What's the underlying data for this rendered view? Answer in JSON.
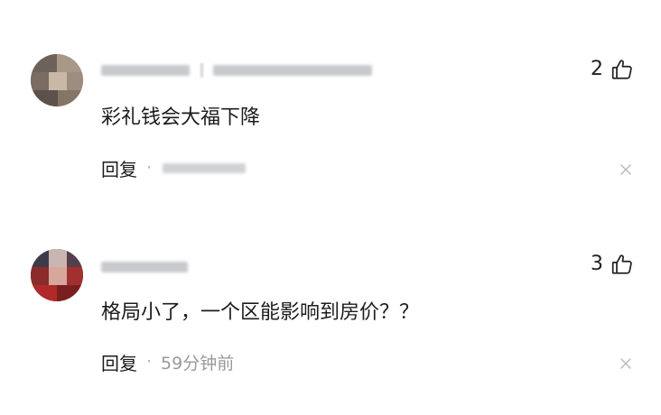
{
  "comments": [
    {
      "username": "",
      "like_count": "2",
      "text": "彩礼钱会大福下降",
      "reply_label": "回复",
      "separator": "·",
      "time": ""
    },
    {
      "username": "",
      "like_count": "3",
      "text": "格局小了，一个区能影响到房价？？",
      "reply_label": "回复",
      "separator": "·",
      "time": "59分钟前"
    }
  ],
  "icons": {
    "like": "thumbs-up-icon",
    "close": "close-icon"
  },
  "colors": {
    "text": "#1c1c1c",
    "muted": "#999999",
    "background": "#ffffff"
  }
}
